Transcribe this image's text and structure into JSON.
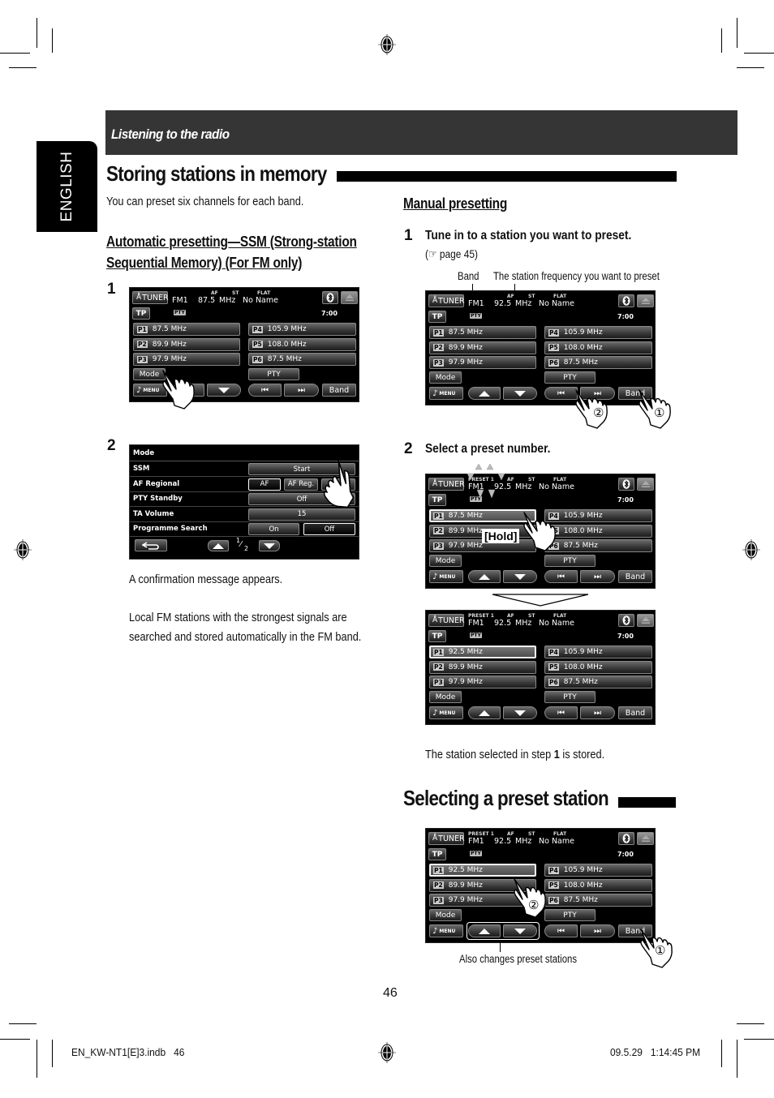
{
  "header": {
    "section": "Listening to the radio",
    "language_tab": "ENGLISH"
  },
  "storing": {
    "title": "Storing stations in memory",
    "intro": "You can preset six channels for each band.",
    "auto": {
      "heading_line1": "Automatic presetting—SSM (Strong-station ",
      "heading_line2": "Sequential Memory) (For FM only)",
      "step1_num": "1",
      "step2_num": "2",
      "note1": "A confirmation message appears.",
      "note2_line1": "Local FM stations with the strongest signals are",
      "note2_line2": "searched and stored automatically in the FM band."
    },
    "manual": {
      "heading": "Manual presetting",
      "step1_num": "1",
      "step1_text": "Tune in to a station you want to preset.",
      "step1_ref": "(☞ page 45)",
      "callout_band": "Band",
      "callout_freq": "The station frequency you want to preset",
      "step2_num": "2",
      "step2_text": "Select a preset number.",
      "hold_label": "[Hold]",
      "stored_pre": "The station selected in step ",
      "stored_num": "1",
      "stored_post": " is stored.",
      "mark1": "①",
      "mark2": "②"
    }
  },
  "selecting": {
    "title": "Selecting a preset station",
    "caption": "Also changes preset stations",
    "mark1": "①",
    "mark2": "②"
  },
  "screens": {
    "s1": {
      "source": "TUNER",
      "band": "FM1",
      "freq": "87.5",
      "unit": "MHz",
      "name": "No Name",
      "preset": "",
      "clock": "7:00",
      "presets": [
        "87.5 MHz",
        "89.9 MHz",
        "97.9 MHz",
        "105.9 MHz",
        "108.0 MHz",
        "87.5 MHz"
      ],
      "selected": -1
    },
    "s2": {
      "source": "TUNER",
      "band": "FM1",
      "freq": "92.5",
      "unit": "MHz",
      "name": "No Name",
      "preset": "",
      "clock": "7:00",
      "presets": [
        "87.5 MHz",
        "89.9 MHz",
        "97.9 MHz",
        "105.9 MHz",
        "108.0 MHz",
        "87.5 MHz"
      ],
      "selected": -1
    },
    "s3": {
      "source": "TUNER",
      "band": "FM1",
      "freq": "92.5",
      "unit": "MHz",
      "name": "No Name",
      "preset": "PRESET 1",
      "clock": "7:00",
      "presets": [
        "87.5 MHz",
        "89.9 MHz",
        "97.9 MHz",
        "105.9 MHz",
        "108.0 MHz",
        "87.5 MHz"
      ],
      "selected": 0
    },
    "s4": {
      "source": "TUNER",
      "band": "FM1",
      "freq": "92.5",
      "unit": "MHz",
      "name": "No Name",
      "preset": "PRESET 1",
      "clock": "7:00",
      "presets": [
        "92.5 MHz",
        "89.9 MHz",
        "97.9 MHz",
        "105.9 MHz",
        "108.0 MHz",
        "87.5 MHz"
      ],
      "selected": 0
    },
    "s5": {
      "source": "TUNER",
      "band": "FM1",
      "freq": "92.5",
      "unit": "MHz",
      "name": "No Name",
      "preset": "PRESET 1",
      "clock": "7:00",
      "presets": [
        "92.5 MHz",
        "89.9 MHz",
        "97.9 MHz",
        "105.9 MHz",
        "108.0 MHz",
        "87.5 MHz"
      ],
      "selected": 0
    }
  },
  "screen_labels": {
    "af": "AF",
    "st": "ST",
    "flat": "FLAT",
    "tp": "TP",
    "pty_icon": "PTY",
    "preset_badges": [
      "P1",
      "P2",
      "P3",
      "P4",
      "P5",
      "P6"
    ],
    "mode": "Mode",
    "pty": "PTY",
    "menu": "MENU",
    "band": "Band",
    "prev": "⏮",
    "next": "⏭"
  },
  "mode_screen": {
    "title": "Mode",
    "rows": [
      {
        "label": "SSM",
        "options": [
          "Start"
        ]
      },
      {
        "label": "AF Regional",
        "options": [
          "AF",
          "AF Reg.",
          ""
        ]
      },
      {
        "label": "PTY Standby",
        "options": [
          "Off"
        ]
      },
      {
        "label": "TA Volume",
        "options": [
          "15"
        ]
      },
      {
        "label": "Programme Search",
        "options": [
          "On",
          "Off"
        ]
      }
    ],
    "page_num": "1",
    "page_den": "2"
  },
  "footer": {
    "page_number": "46",
    "file": "EN_KW-NT1[E]3.indb   46",
    "timestamp": "09.5.29   1:14:45 PM"
  }
}
